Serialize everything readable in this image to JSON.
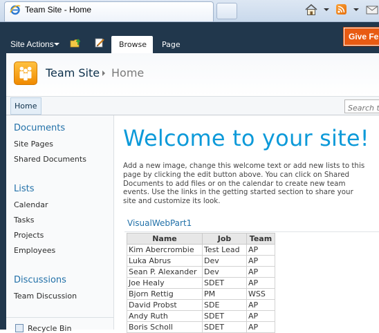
{
  "browser": {
    "tab_title": "Team Site - Home"
  },
  "ribbon": {
    "site_actions": "Site Actions",
    "tabs": [
      "Browse",
      "Page"
    ],
    "feedback": "Give Fe"
  },
  "header": {
    "site_title": "Team Site",
    "current_page": "Home"
  },
  "topnav": {
    "home": "Home",
    "search_placeholder": "Search t"
  },
  "quicklaunch": {
    "sections": [
      {
        "heading": "Documents",
        "items": [
          "Site Pages",
          "Shared Documents"
        ]
      },
      {
        "heading": "Lists",
        "items": [
          "Calendar",
          "Tasks",
          "Projects",
          "Employees"
        ]
      },
      {
        "heading": "Discussions",
        "items": [
          "Team Discussion"
        ]
      }
    ],
    "recycle_bin": "Recycle Bin"
  },
  "main": {
    "welcome": "Welcome to your site!",
    "body": "Add a new image, change this welcome text or add new lists to this page by clicking the edit button above. You can click on Shared Documents to add files or on the calendar to create new team events. Use the links in the getting started section to share your site and customize its look.",
    "webpart": {
      "title": "VisualWebPart1",
      "columns": [
        "Name",
        "Job",
        "Team"
      ],
      "rows": [
        [
          "Kim Abercrombie",
          "Test Lead",
          "AP"
        ],
        [
          "Luka Abrus",
          "Dev",
          "AP"
        ],
        [
          "Sean P. Alexander",
          "Dev",
          "AP"
        ],
        [
          "Joe Healy",
          "SDET",
          "AP"
        ],
        [
          "Bjorn Rettig",
          "PM",
          "WSS"
        ],
        [
          "David Probst",
          "SDE",
          "AP"
        ],
        [
          "Andy Ruth",
          "SDET",
          "AP"
        ],
        [
          "Boris Scholl",
          "SDET",
          "AP"
        ]
      ]
    }
  },
  "colors": {
    "ribbon": "#21374c",
    "accent": "#0d9ad9",
    "link": "#2170a8",
    "feedback": "#e85b13"
  }
}
